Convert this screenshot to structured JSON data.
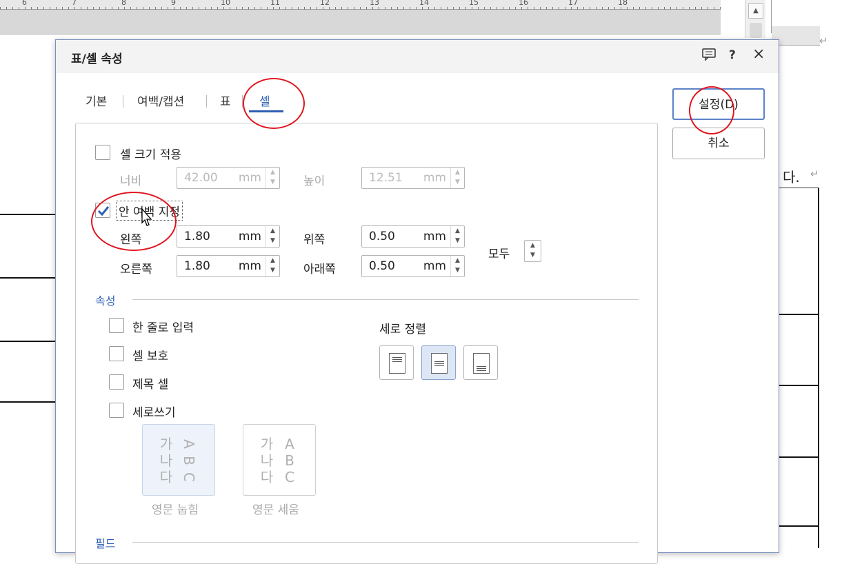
{
  "ruler": {
    "numbers": [
      "6",
      "7",
      "8",
      "9",
      "10",
      "11",
      "12",
      "13",
      "14",
      "15",
      "16",
      "17",
      "18"
    ]
  },
  "doc": {
    "right_text": "다.",
    "para_mark": "↵"
  },
  "dialog": {
    "title": "표/셀 속성",
    "icons": {
      "comment": "comment-icon",
      "help": "?",
      "close": "×"
    },
    "tabs": [
      "기본",
      "여백/캡션",
      "표",
      "셀"
    ],
    "active_tab": "셀",
    "buttons": {
      "ok": "설정(D)",
      "cancel": "취소"
    },
    "cell_size": {
      "label": "셀 크기 적용",
      "checked": false,
      "width_label": "너비",
      "width_value": "42.00",
      "height_label": "높이",
      "height_value": "12.51",
      "unit": "mm"
    },
    "margin": {
      "label": "안 여백 지정",
      "checked": true,
      "left_label": "왼쪽",
      "left_value": "1.80",
      "right_label": "오른쪽",
      "right_value": "1.80",
      "top_label": "위쪽",
      "top_value": "0.50",
      "bottom_label": "아래쪽",
      "bottom_value": "0.50",
      "unit": "mm",
      "all_label": "모두"
    },
    "props": {
      "section_label": "속성",
      "one_line": "한 줄로 입력",
      "protect": "셀 보호",
      "title_cell": "제목 셀",
      "vertical_write": "세로쓰기",
      "valign_label": "세로 정렬",
      "valign_selected": "center"
    },
    "samples": {
      "lying": {
        "label": "영문 눕힘",
        "korean": [
          "가",
          "나",
          "다"
        ],
        "latin": [
          "A",
          "B",
          "C"
        ]
      },
      "standing": {
        "label": "영문 세움",
        "korean": [
          "가",
          "나",
          "다"
        ],
        "latin": [
          "A",
          "B",
          "C"
        ]
      }
    },
    "field_section": "필드"
  },
  "colors": {
    "accent": "#2f5fb0",
    "annotation": "#e0141e"
  }
}
